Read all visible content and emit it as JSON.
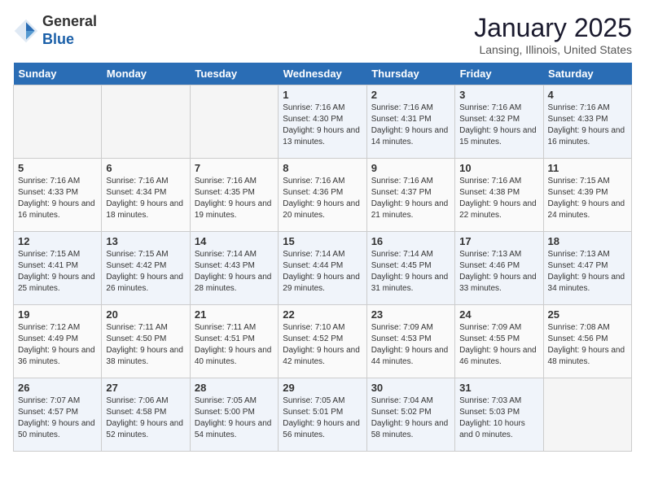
{
  "header": {
    "logo_general": "General",
    "logo_blue": "Blue",
    "month_title": "January 2025",
    "location": "Lansing, Illinois, United States"
  },
  "weekdays": [
    "Sunday",
    "Monday",
    "Tuesday",
    "Wednesday",
    "Thursday",
    "Friday",
    "Saturday"
  ],
  "weeks": [
    [
      {
        "day": "",
        "empty": true
      },
      {
        "day": "",
        "empty": true
      },
      {
        "day": "",
        "empty": true
      },
      {
        "day": "1",
        "sunrise": "Sunrise: 7:16 AM",
        "sunset": "Sunset: 4:30 PM",
        "daylight": "Daylight: 9 hours and 13 minutes."
      },
      {
        "day": "2",
        "sunrise": "Sunrise: 7:16 AM",
        "sunset": "Sunset: 4:31 PM",
        "daylight": "Daylight: 9 hours and 14 minutes."
      },
      {
        "day": "3",
        "sunrise": "Sunrise: 7:16 AM",
        "sunset": "Sunset: 4:32 PM",
        "daylight": "Daylight: 9 hours and 15 minutes."
      },
      {
        "day": "4",
        "sunrise": "Sunrise: 7:16 AM",
        "sunset": "Sunset: 4:33 PM",
        "daylight": "Daylight: 9 hours and 16 minutes."
      }
    ],
    [
      {
        "day": "5",
        "sunrise": "Sunrise: 7:16 AM",
        "sunset": "Sunset: 4:33 PM",
        "daylight": "Daylight: 9 hours and 16 minutes."
      },
      {
        "day": "6",
        "sunrise": "Sunrise: 7:16 AM",
        "sunset": "Sunset: 4:34 PM",
        "daylight": "Daylight: 9 hours and 18 minutes."
      },
      {
        "day": "7",
        "sunrise": "Sunrise: 7:16 AM",
        "sunset": "Sunset: 4:35 PM",
        "daylight": "Daylight: 9 hours and 19 minutes."
      },
      {
        "day": "8",
        "sunrise": "Sunrise: 7:16 AM",
        "sunset": "Sunset: 4:36 PM",
        "daylight": "Daylight: 9 hours and 20 minutes."
      },
      {
        "day": "9",
        "sunrise": "Sunrise: 7:16 AM",
        "sunset": "Sunset: 4:37 PM",
        "daylight": "Daylight: 9 hours and 21 minutes."
      },
      {
        "day": "10",
        "sunrise": "Sunrise: 7:16 AM",
        "sunset": "Sunset: 4:38 PM",
        "daylight": "Daylight: 9 hours and 22 minutes."
      },
      {
        "day": "11",
        "sunrise": "Sunrise: 7:15 AM",
        "sunset": "Sunset: 4:39 PM",
        "daylight": "Daylight: 9 hours and 24 minutes."
      }
    ],
    [
      {
        "day": "12",
        "sunrise": "Sunrise: 7:15 AM",
        "sunset": "Sunset: 4:41 PM",
        "daylight": "Daylight: 9 hours and 25 minutes."
      },
      {
        "day": "13",
        "sunrise": "Sunrise: 7:15 AM",
        "sunset": "Sunset: 4:42 PM",
        "daylight": "Daylight: 9 hours and 26 minutes."
      },
      {
        "day": "14",
        "sunrise": "Sunrise: 7:14 AM",
        "sunset": "Sunset: 4:43 PM",
        "daylight": "Daylight: 9 hours and 28 minutes."
      },
      {
        "day": "15",
        "sunrise": "Sunrise: 7:14 AM",
        "sunset": "Sunset: 4:44 PM",
        "daylight": "Daylight: 9 hours and 29 minutes."
      },
      {
        "day": "16",
        "sunrise": "Sunrise: 7:14 AM",
        "sunset": "Sunset: 4:45 PM",
        "daylight": "Daylight: 9 hours and 31 minutes."
      },
      {
        "day": "17",
        "sunrise": "Sunrise: 7:13 AM",
        "sunset": "Sunset: 4:46 PM",
        "daylight": "Daylight: 9 hours and 33 minutes."
      },
      {
        "day": "18",
        "sunrise": "Sunrise: 7:13 AM",
        "sunset": "Sunset: 4:47 PM",
        "daylight": "Daylight: 9 hours and 34 minutes."
      }
    ],
    [
      {
        "day": "19",
        "sunrise": "Sunrise: 7:12 AM",
        "sunset": "Sunset: 4:49 PM",
        "daylight": "Daylight: 9 hours and 36 minutes."
      },
      {
        "day": "20",
        "sunrise": "Sunrise: 7:11 AM",
        "sunset": "Sunset: 4:50 PM",
        "daylight": "Daylight: 9 hours and 38 minutes."
      },
      {
        "day": "21",
        "sunrise": "Sunrise: 7:11 AM",
        "sunset": "Sunset: 4:51 PM",
        "daylight": "Daylight: 9 hours and 40 minutes."
      },
      {
        "day": "22",
        "sunrise": "Sunrise: 7:10 AM",
        "sunset": "Sunset: 4:52 PM",
        "daylight": "Daylight: 9 hours and 42 minutes."
      },
      {
        "day": "23",
        "sunrise": "Sunrise: 7:09 AM",
        "sunset": "Sunset: 4:53 PM",
        "daylight": "Daylight: 9 hours and 44 minutes."
      },
      {
        "day": "24",
        "sunrise": "Sunrise: 7:09 AM",
        "sunset": "Sunset: 4:55 PM",
        "daylight": "Daylight: 9 hours and 46 minutes."
      },
      {
        "day": "25",
        "sunrise": "Sunrise: 7:08 AM",
        "sunset": "Sunset: 4:56 PM",
        "daylight": "Daylight: 9 hours and 48 minutes."
      }
    ],
    [
      {
        "day": "26",
        "sunrise": "Sunrise: 7:07 AM",
        "sunset": "Sunset: 4:57 PM",
        "daylight": "Daylight: 9 hours and 50 minutes."
      },
      {
        "day": "27",
        "sunrise": "Sunrise: 7:06 AM",
        "sunset": "Sunset: 4:58 PM",
        "daylight": "Daylight: 9 hours and 52 minutes."
      },
      {
        "day": "28",
        "sunrise": "Sunrise: 7:05 AM",
        "sunset": "Sunset: 5:00 PM",
        "daylight": "Daylight: 9 hours and 54 minutes."
      },
      {
        "day": "29",
        "sunrise": "Sunrise: 7:05 AM",
        "sunset": "Sunset: 5:01 PM",
        "daylight": "Daylight: 9 hours and 56 minutes."
      },
      {
        "day": "30",
        "sunrise": "Sunrise: 7:04 AM",
        "sunset": "Sunset: 5:02 PM",
        "daylight": "Daylight: 9 hours and 58 minutes."
      },
      {
        "day": "31",
        "sunrise": "Sunrise: 7:03 AM",
        "sunset": "Sunset: 5:03 PM",
        "daylight": "Daylight: 10 hours and 0 minutes."
      },
      {
        "day": "",
        "empty": true
      }
    ]
  ]
}
